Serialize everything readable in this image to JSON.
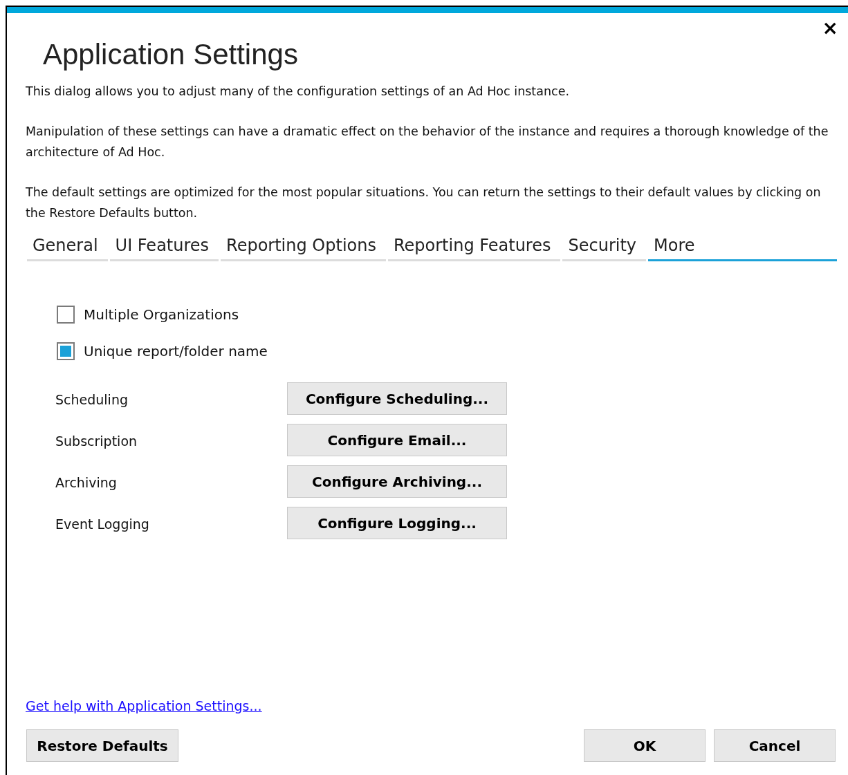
{
  "window": {
    "title": "Application Settings",
    "close": "×"
  },
  "intro": [
    "This dialog allows you to adjust many of the configuration settings of an Ad Hoc instance.",
    "Manipulation of these settings can have a dramatic effect on the behavior of the instance and requires a thorough knowledge of the architecture of Ad Hoc.",
    "The default settings are optimized for the most popular situations. You can return the settings to their default values by clicking on the Restore Defaults button."
  ],
  "tabs": [
    {
      "label": "General",
      "selected": false
    },
    {
      "label": "UI Features",
      "selected": false
    },
    {
      "label": "Reporting Options",
      "selected": false
    },
    {
      "label": "Reporting Features",
      "selected": false
    },
    {
      "label": "Security",
      "selected": false
    },
    {
      "label": "More",
      "selected": true
    }
  ],
  "checkboxes": [
    {
      "label": "Multiple Organizations",
      "checked": false
    },
    {
      "label": "Unique report/folder name",
      "checked": true
    }
  ],
  "settings": [
    {
      "label": "Scheduling",
      "button": "Configure Scheduling..."
    },
    {
      "label": "Subscription",
      "button": "Configure Email..."
    },
    {
      "label": "Archiving",
      "button": "Configure Archiving..."
    },
    {
      "label": "Event Logging",
      "button": "Configure Logging..."
    }
  ],
  "help_link": "Get help with Application Settings...",
  "buttons": {
    "restore": "Restore Defaults",
    "ok": "OK",
    "cancel": "Cancel"
  }
}
